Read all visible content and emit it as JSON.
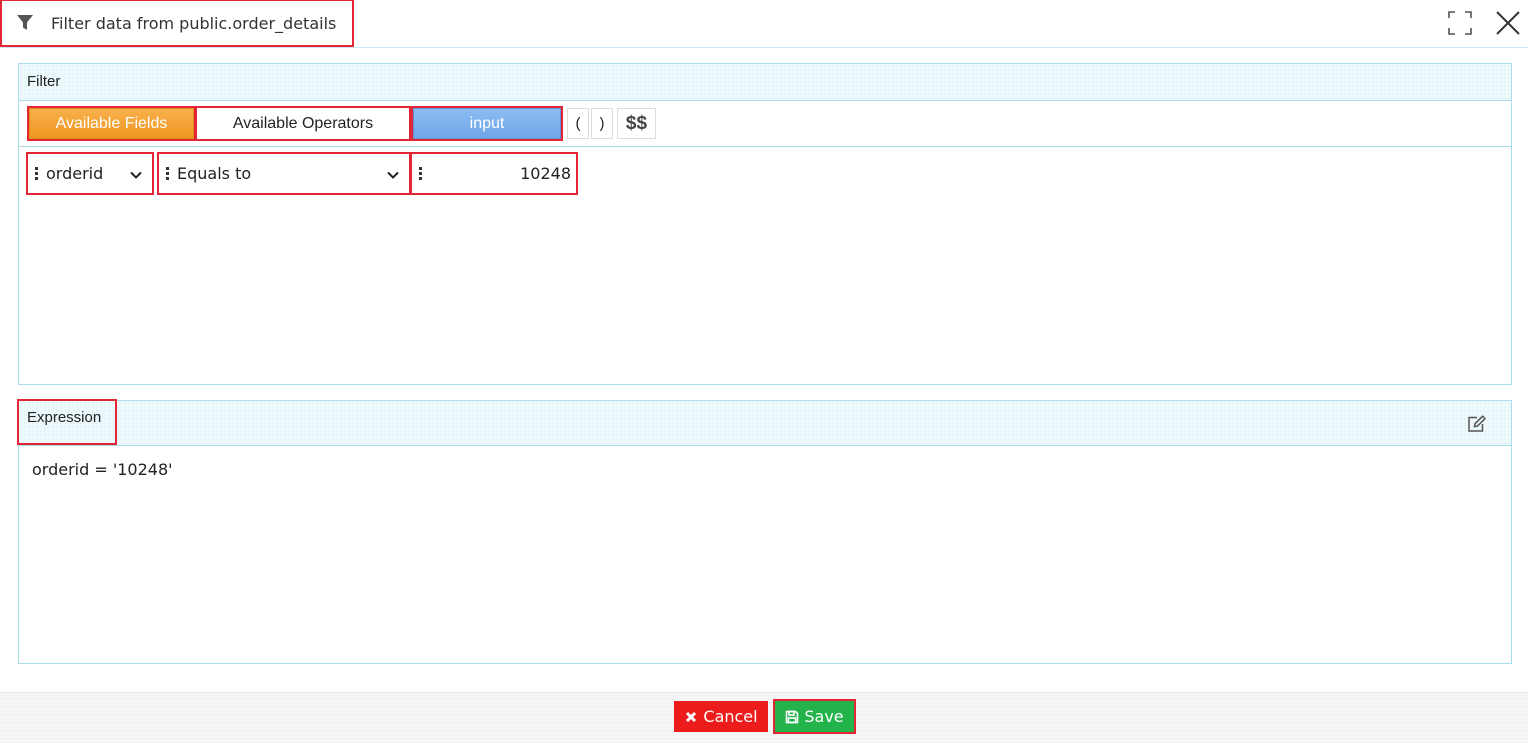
{
  "dialog": {
    "title": "Filter data from public.order_details",
    "icons": {
      "title": "filter-icon",
      "maximize": "maximize-icon",
      "close": "close-icon"
    }
  },
  "filter_panel": {
    "heading": "Filter",
    "toolbar": {
      "available_fields": "Available Fields",
      "available_operators": "Available Operators",
      "input": "input",
      "open_paren": "(",
      "close_paren": ")",
      "dollars": "$$"
    },
    "condition": {
      "field": "orderid",
      "operator": "Equals to",
      "value": "10248"
    }
  },
  "expression_panel": {
    "heading": "Expression",
    "text": "orderid = '10248'",
    "edit_icon": "edit-icon"
  },
  "footer": {
    "cancel_label": "Cancel",
    "save_label": "Save"
  },
  "colors": {
    "fields_orange": "#f5a43a",
    "input_blue": "#7eb3ef",
    "cancel_red": "#ec1c1c",
    "save_green": "#23b34a",
    "highlight_red": "#e32636",
    "panel_border": "#a9ddea"
  }
}
